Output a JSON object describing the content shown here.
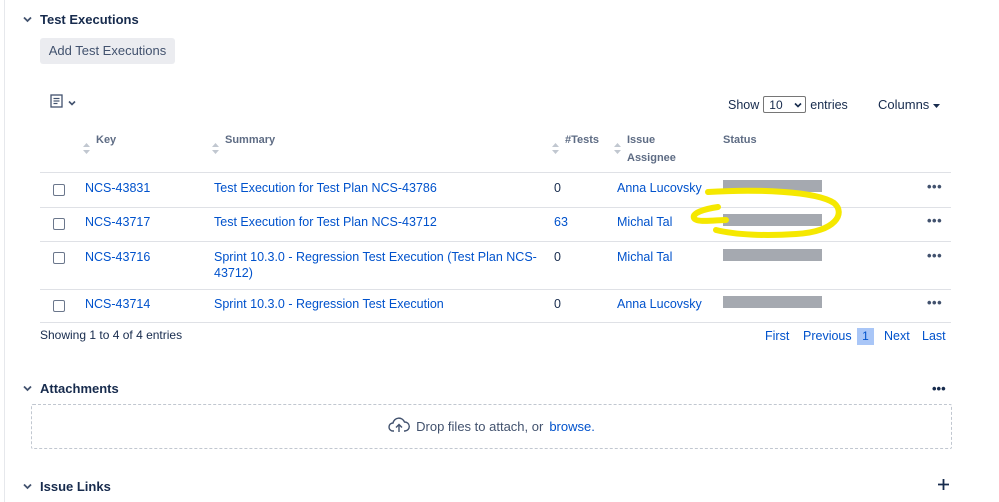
{
  "test_executions": {
    "title": "Test Executions",
    "add_button": "Add Test Executions",
    "show_label": "Show",
    "show_value": "10",
    "entries_label": "entries",
    "columns_label": "Columns",
    "headers": {
      "key": "Key",
      "summary": "Summary",
      "tests": "#Tests",
      "assignee_line1": "Issue",
      "assignee_line2": "Assignee",
      "status": "Status"
    },
    "rows": [
      {
        "key": "NCS-43831",
        "summary_line1": "Test Execution for Test Plan NCS-43786",
        "summary_line2": "",
        "tests": "0",
        "assignee": "Anna Lucovsky"
      },
      {
        "key": "NCS-43717",
        "summary_line1": "Test Execution for Test Plan NCS-43712",
        "summary_line2": "",
        "tests": "63",
        "assignee": "Michal Tal"
      },
      {
        "key": "NCS-43716",
        "summary_line1": "Sprint 10.3.0 - Regression Test Execution (Test Plan NCS-",
        "summary_line2": "43712)",
        "tests": "0",
        "assignee": "Michal Tal"
      },
      {
        "key": "NCS-43714",
        "summary_line1": "Sprint 10.3.0 - Regression Test Execution",
        "summary_line2": "",
        "tests": "0",
        "assignee": "Anna Lucovsky"
      }
    ],
    "row_menu": "•••",
    "showing_text": "Showing 1 to 4 of 4 entries",
    "pager": {
      "first": "First",
      "previous": "Previous",
      "current": "1",
      "next": "Next",
      "last": "Last"
    }
  },
  "attachments": {
    "title": "Attachments",
    "menu": "•••",
    "drop_text": "Drop files to attach, or",
    "browse": "browse."
  },
  "issue_links": {
    "title": "Issue Links"
  },
  "colors": {
    "link": "#0052cc",
    "status_redacted": "#a5a9b0",
    "highlight": "#f5e800",
    "pager_current_bg": "#a9c6f7"
  },
  "icons": [
    "chevron-down-icon",
    "column-picker-icon",
    "sort-icon",
    "cloud-upload-icon",
    "plus-icon",
    "more-icon"
  ]
}
